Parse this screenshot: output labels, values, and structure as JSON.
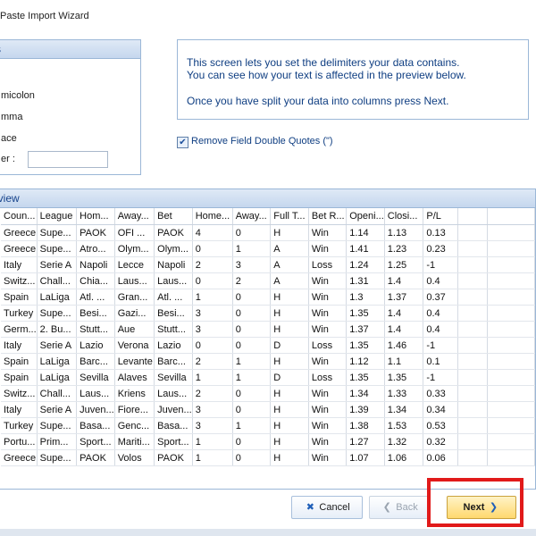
{
  "window": {
    "title": "Paste Import Wizard"
  },
  "delimiters": {
    "header": "rs",
    "options": [
      "micolon",
      "mma",
      "ace"
    ],
    "other_label": "er :",
    "other_value": ""
  },
  "info": {
    "line1": "This screen lets you set the delimiters your data contains.",
    "line2": "You can see how your text is affected in the preview below.",
    "line3": "Once you have split your data into columns press Next."
  },
  "quotes": {
    "label": "Remove Field Double Quotes (\")",
    "checked": true
  },
  "preview": {
    "header": "eview",
    "columns": [
      "Coun...",
      "League",
      "Hom...",
      "Away...",
      "Bet",
      "Home...",
      "Away...",
      "Full T...",
      "Bet R...",
      "Openi...",
      "Closi...",
      "P/L",
      "",
      ""
    ],
    "rows": [
      [
        "Greece",
        "Supe...",
        "PAOK",
        "OFI ...",
        "PAOK",
        "4",
        "0",
        "H",
        "Win",
        "1.14",
        "1.13",
        "0.13"
      ],
      [
        "Greece",
        "Supe...",
        "Atro...",
        "Olym...",
        "Olym...",
        "0",
        "1",
        "A",
        "Win",
        "1.41",
        "1.23",
        "0.23"
      ],
      [
        "Italy",
        "Serie A",
        "Napoli",
        "Lecce",
        "Napoli",
        "2",
        "3",
        "A",
        "Loss",
        "1.24",
        "1.25",
        "-1"
      ],
      [
        "Switz...",
        "Chall...",
        "Chia...",
        "Laus...",
        "Laus...",
        "0",
        "2",
        "A",
        "Win",
        "1.31",
        "1.4",
        "0.4"
      ],
      [
        "Spain",
        "LaLiga",
        "Atl. ...",
        "Gran...",
        "Atl. ...",
        "1",
        "0",
        "H",
        "Win",
        "1.3",
        "1.37",
        "0.37"
      ],
      [
        "Turkey",
        "Supe...",
        "Besi...",
        "Gazi...",
        "Besi...",
        "3",
        "0",
        "H",
        "Win",
        "1.35",
        "1.4",
        "0.4"
      ],
      [
        "Germ...",
        "2. Bu...",
        "Stutt...",
        "Aue",
        "Stutt...",
        "3",
        "0",
        "H",
        "Win",
        "1.37",
        "1.4",
        "0.4"
      ],
      [
        "Italy",
        "Serie A",
        "Lazio",
        "Verona",
        "Lazio",
        "0",
        "0",
        "D",
        "Loss",
        "1.35",
        "1.46",
        "-1"
      ],
      [
        "Spain",
        "LaLiga",
        "Barc...",
        "Levante",
        "Barc...",
        "2",
        "1",
        "H",
        "Win",
        "1.12",
        "1.1",
        "0.1"
      ],
      [
        "Spain",
        "LaLiga",
        "Sevilla",
        "Alaves",
        "Sevilla",
        "1",
        "1",
        "D",
        "Loss",
        "1.35",
        "1.35",
        "-1"
      ],
      [
        "Switz...",
        "Chall...",
        "Laus...",
        "Kriens",
        "Laus...",
        "2",
        "0",
        "H",
        "Win",
        "1.34",
        "1.33",
        "0.33"
      ],
      [
        "Italy",
        "Serie A",
        "Juven...",
        "Fiore...",
        "Juven...",
        "3",
        "0",
        "H",
        "Win",
        "1.39",
        "1.34",
        "0.34"
      ],
      [
        "Turkey",
        "Supe...",
        "Basa...",
        "Genc...",
        "Basa...",
        "3",
        "1",
        "H",
        "Win",
        "1.38",
        "1.53",
        "0.53"
      ],
      [
        "Portu...",
        "Prim...",
        "Sport...",
        "Mariti...",
        "Sport...",
        "1",
        "0",
        "H",
        "Win",
        "1.27",
        "1.32",
        "0.32"
      ],
      [
        "Greece",
        "Supe...",
        "PAOK",
        "Volos",
        "PAOK",
        "1",
        "0",
        "H",
        "Win",
        "1.07",
        "1.06",
        "0.06"
      ]
    ]
  },
  "buttons": {
    "cancel": "Cancel",
    "back": "Back",
    "next": "Next"
  },
  "colors": {
    "accent": "#15428b",
    "highlight": "#e11a1a",
    "next_fill": "#ffd86e"
  },
  "icons": {
    "cancel": "x-icon",
    "back": "chevron-left-icon",
    "next": "chevron-right-icon"
  }
}
